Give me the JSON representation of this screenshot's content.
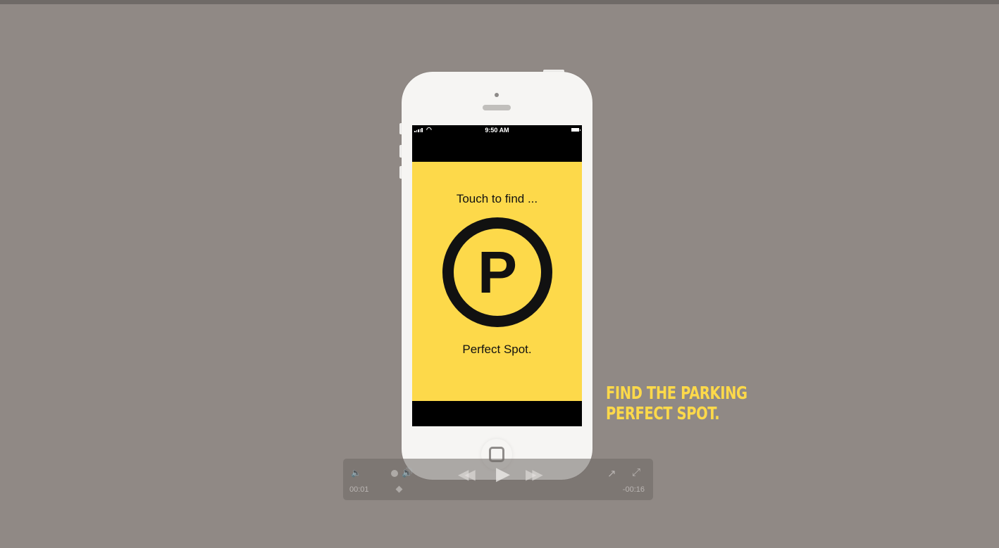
{
  "status_bar": {
    "time": "9:50 AM",
    "wifi_icon": "wifi-icon",
    "signal_icon": "signal-bars-icon",
    "battery_icon": "battery-icon"
  },
  "app_screen": {
    "prompt_text": "Touch to find ...",
    "parking_symbol": "P",
    "result_text": "Perfect Spot.",
    "background_color": "#fdd94a"
  },
  "tagline": {
    "line1": "FIND THE PARKING",
    "line2": "PERFECT SPOT."
  },
  "player": {
    "elapsed": "00:01",
    "remaining": "-00:16",
    "volume_low_icon": "🔈",
    "volume_high_icon": "🔊",
    "rewind_icon": "◀◀",
    "play_icon": "▶",
    "forward_icon": "▶▶",
    "share_icon": "↗",
    "fullscreen_icon": "⤢"
  }
}
